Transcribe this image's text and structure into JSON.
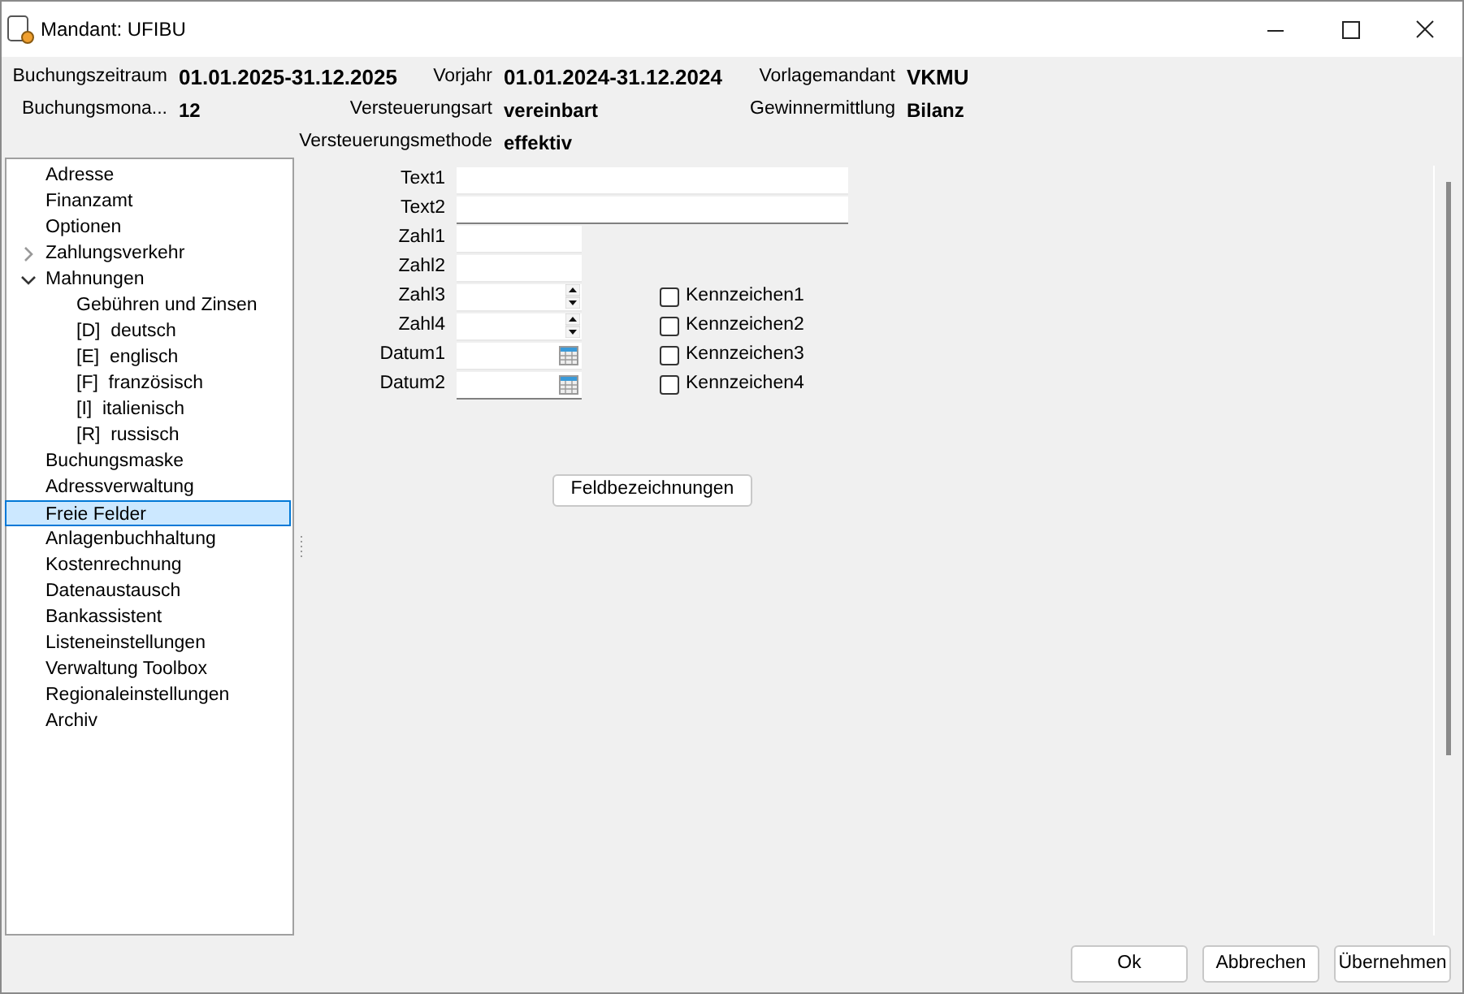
{
  "window": {
    "title": "Mandant: UFIBU"
  },
  "header": {
    "columns": [
      {
        "pairs": [
          {
            "label": "Buchungszeitraum",
            "value": "01.01.2025-31.12.2025"
          },
          {
            "label": "Buchungsmona...",
            "value": "12"
          }
        ]
      },
      {
        "pairs": [
          {
            "label": "Vorjahr",
            "value": "01.01.2024-31.12.2024"
          },
          {
            "label": "Versteuerungsart",
            "value": "vereinbart"
          },
          {
            "label": "Versteuerungsmethode",
            "value": "effektiv"
          }
        ]
      },
      {
        "pairs": [
          {
            "label": "Vorlagemandant",
            "value": "VKMU"
          },
          {
            "label": "Gewinnermittlung",
            "value": "Bilanz"
          }
        ]
      }
    ]
  },
  "sidebar": {
    "items": [
      {
        "label": "Adresse",
        "selected": false
      },
      {
        "label": "Finanzamt",
        "selected": false
      },
      {
        "label": "Optionen",
        "selected": false
      },
      {
        "label": "Zahlungsverkehr",
        "selected": false,
        "expanded": false
      },
      {
        "label": "Mahnungen",
        "selected": false,
        "expanded": true,
        "children": [
          {
            "label": "Gebühren und Zinsen",
            "selected": false
          },
          {
            "label": "[D]  deutsch",
            "selected": false
          },
          {
            "label": "[E]  englisch",
            "selected": false
          },
          {
            "label": "[F]  französisch",
            "selected": false
          },
          {
            "label": "[I]  italienisch",
            "selected": false
          },
          {
            "label": "[R]  russisch",
            "selected": false
          }
        ]
      },
      {
        "label": "Buchungsmaske",
        "selected": false
      },
      {
        "label": "Adressverwaltung",
        "selected": false
      },
      {
        "label": "Freie Felder",
        "selected": true
      },
      {
        "label": "Anlagenbuchhaltung",
        "selected": false
      },
      {
        "label": "Kostenrechnung",
        "selected": false
      },
      {
        "label": "Datenaustausch",
        "selected": false
      },
      {
        "label": "Bankassistent",
        "selected": false
      },
      {
        "label": "Listeneinstellungen",
        "selected": false
      },
      {
        "label": "Verwaltung Toolbox",
        "selected": false
      },
      {
        "label": "Regionaleinstellungen",
        "selected": false
      },
      {
        "label": "Archiv",
        "selected": false
      }
    ]
  },
  "form": {
    "fields": [
      {
        "label": "Text1",
        "kind": "text"
      },
      {
        "label": "Text2",
        "kind": "text"
      },
      {
        "label": "Zahl1",
        "kind": "number"
      },
      {
        "label": "Zahl2",
        "kind": "number"
      },
      {
        "label": "Zahl3",
        "kind": "spin"
      },
      {
        "label": "Zahl4",
        "kind": "spin"
      },
      {
        "label": "Datum1",
        "kind": "date"
      },
      {
        "label": "Datum2",
        "kind": "date"
      }
    ],
    "checkboxes": [
      {
        "label": "Kennzeichen1",
        "checked": false
      },
      {
        "label": "Kennzeichen2",
        "checked": false
      },
      {
        "label": "Kennzeichen3",
        "checked": false
      },
      {
        "label": "Kennzeichen4",
        "checked": false
      }
    ],
    "button": "Feldbezeichnungen"
  },
  "buttons": [
    "Ok",
    "Abbrechen",
    "Übernehmen"
  ]
}
